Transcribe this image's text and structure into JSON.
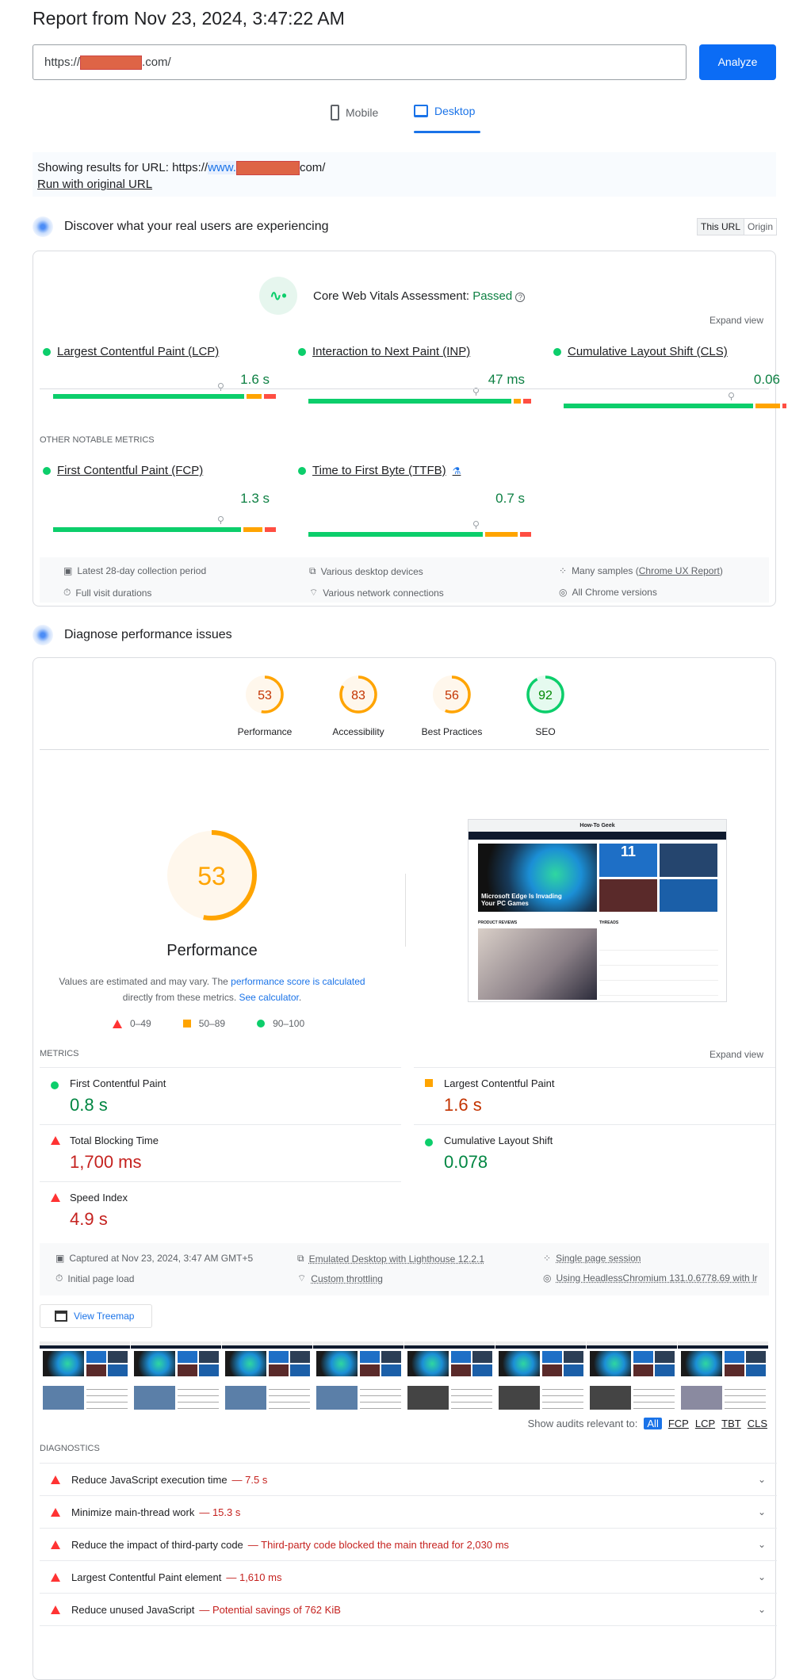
{
  "header": {
    "title": "Report from Nov 23, 2024, 3:47:22 AM",
    "url_prefix": "https://",
    "url_suffix": ".com/",
    "analyze_label": "Analyze"
  },
  "tabs": [
    {
      "label": "Mobile",
      "icon": "phone-icon",
      "active": false
    },
    {
      "label": "Desktop",
      "icon": "laptop-icon",
      "active": true
    }
  ],
  "notice": {
    "text": "Showing results for URL: https://",
    "www": "www.",
    "suffix": "com/",
    "run_original": "Run with original URL"
  },
  "field": {
    "heading": "Discover what your real users are experiencing",
    "toggle": [
      "This URL",
      "Origin"
    ],
    "assessment_label": "Core Web Vitals Assessment:",
    "assessment_value": "Passed",
    "expand": "Expand view",
    "core": [
      {
        "name": "Largest Contentful Paint (LCP)",
        "value": "1.6 s",
        "dist": [
          0.875,
          0.07,
          0.055
        ]
      },
      {
        "name": "Interaction to Next Paint (INP)",
        "value": "47 ms",
        "dist": [
          0.93,
          0.035,
          0.035
        ]
      },
      {
        "name": "Cumulative Layout Shift (CLS)",
        "value": "0.06",
        "dist": [
          0.87,
          0.11,
          0.02
        ]
      }
    ],
    "other_heading": "OTHER NOTABLE METRICS",
    "other": [
      {
        "name": "First Contentful Paint (FCP)",
        "value": "1.3 s",
        "dist": [
          0.86,
          0.09,
          0.05
        ]
      },
      {
        "name": "Time to First Byte (TTFB)",
        "value": "0.7 s",
        "dist": [
          0.8,
          0.15,
          0.05
        ]
      }
    ],
    "info": [
      "Latest 28-day collection period",
      "Various desktop devices",
      "Many samples (",
      "Chrome UX Report",
      ")",
      "Full visit durations",
      "Various network connections",
      "All Chrome versions"
    ]
  },
  "lab": {
    "heading": "Diagnose performance issues",
    "scores": [
      {
        "label": "Performance",
        "score": 53
      },
      {
        "label": "Accessibility",
        "score": 83
      },
      {
        "label": "Best Practices",
        "score": 56
      },
      {
        "label": "SEO",
        "score": 92
      }
    ],
    "big_score": 53,
    "big_label": "Performance",
    "desc": [
      "Values are estimated and may vary. The ",
      "performance score is calculated",
      " directly from these metrics. ",
      "See calculator",
      "."
    ],
    "legend": [
      "0–49",
      "50–89",
      "90–100"
    ],
    "metrics_heading": "METRICS",
    "expand": "Expand view",
    "metrics": [
      {
        "label": "First Contentful Paint",
        "value": "0.8 s",
        "rating": "pass"
      },
      {
        "label": "Largest Contentful Paint",
        "value": "1.6 s",
        "rating": "average"
      },
      {
        "label": "Total Blocking Time",
        "value": "1,700 ms",
        "rating": "fail"
      },
      {
        "label": "Cumulative Layout Shift",
        "value": "0.078",
        "rating": "pass"
      },
      {
        "label": "Speed Index",
        "value": "4.9 s",
        "rating": "fail"
      }
    ],
    "info": [
      "Captured at Nov 23, 2024, 3:47 AM GMT+5",
      "Emulated Desktop with Lighthouse 12.2.1",
      "Single page session",
      "Initial page load",
      "Custom throttling",
      "Using HeadlessChromium 131.0.6778.69 with lr"
    ],
    "treemap": "View Treemap",
    "screenshot": {
      "site": "How-To Geek",
      "headline": "Microsoft Edge Is Invading Your PC Games",
      "reviews": "PRODUCT REVIEWS",
      "threads": "THREADS",
      "tile1_num": "11"
    },
    "filter_label": "Show audits relevant to:",
    "filters": [
      "All",
      "FCP",
      "LCP",
      "TBT",
      "CLS"
    ],
    "diag_heading": "DIAGNOSTICS",
    "diagnostics": [
      {
        "title": "Reduce JavaScript execution time",
        "detail": "7.5 s"
      },
      {
        "title": "Minimize main-thread work",
        "detail": "15.3 s"
      },
      {
        "title": "Reduce the impact of third-party code",
        "detail": "Third-party code blocked the main thread for 2,030 ms"
      },
      {
        "title": "Largest Contentful Paint element",
        "detail": "1,610 ms"
      },
      {
        "title": "Reduce unused JavaScript",
        "detail": "Potential savings of 762 KiB"
      }
    ]
  },
  "colors": {
    "pass": "#0cce6b",
    "average": "#ffa400",
    "fail": "#ff4e42",
    "accent": "#1a73e8"
  }
}
